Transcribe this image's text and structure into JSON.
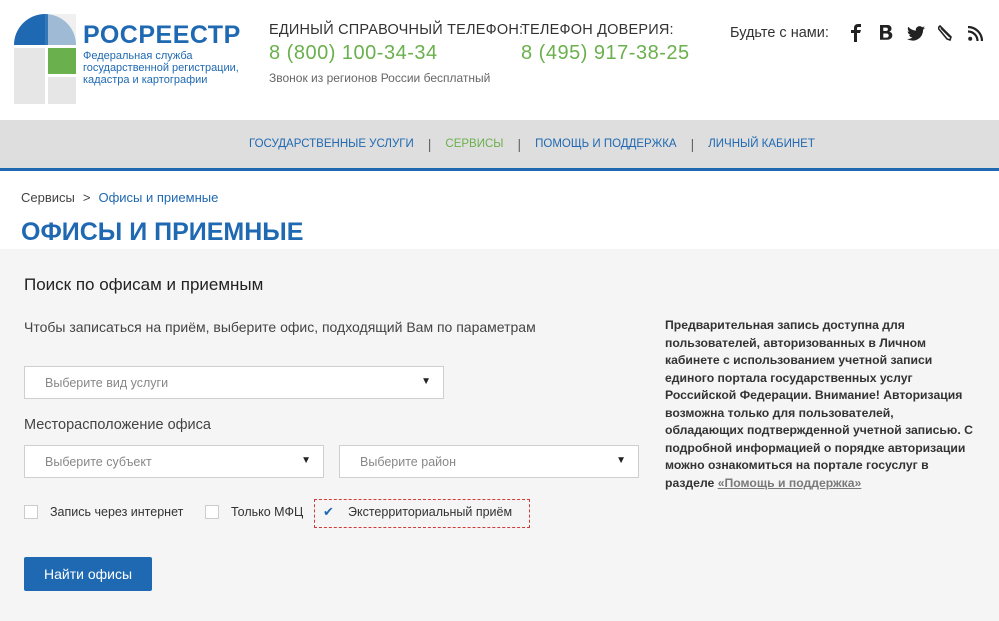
{
  "brand": {
    "name": "РОСРЕЕСТР",
    "subtitle": "Федеральная служба государственной регистрации, кадастра и картографии"
  },
  "phones": [
    {
      "caption": "ЕДИНЫЙ СПРАВОЧНЫЙ ТЕЛЕФОН:",
      "number": "8 (800) 100-34-34",
      "note": "Звонок из регионов России бесплатный"
    },
    {
      "caption": "ТЕЛЕФОН ДОВЕРИЯ:",
      "number": "8 (495) 917-38-25"
    }
  ],
  "social": {
    "label": "Будьте с нами:",
    "icons": [
      "facebook-icon",
      "vkontakte-icon",
      "twitter-icon",
      "livejournal-icon",
      "rss-icon"
    ]
  },
  "nav": {
    "items": [
      {
        "label": "ГОСУДАРСТВЕННЫЕ УСЛУГИ",
        "active": false
      },
      {
        "label": "СЕРВИСЫ",
        "active": true
      },
      {
        "label": "ПОМОЩЬ И ПОДДЕРЖКА",
        "active": false
      },
      {
        "label": "ЛИЧНЫЙ КАБИНЕТ",
        "active": false
      }
    ],
    "separator": "|"
  },
  "breadcrumb": {
    "root": "Сервисы",
    "sep": ">",
    "current": "Офисы и приемные"
  },
  "page_title": "ОФИСЫ И ПРИЕМНЫЕ",
  "search": {
    "title": "Поиск по офисам и приемным",
    "hint": "Чтобы записаться на приём, выберите офис, подходящий Вам по параметрам",
    "service_placeholder": "Выберите вид услуги",
    "location_label": "Месторасположение офиса",
    "subject_placeholder": "Выберите субъект",
    "district_placeholder": "Выберите район",
    "checkboxes": [
      {
        "label": "Запись через интернет",
        "checked": false
      },
      {
        "label": "Только МФЦ",
        "checked": false
      },
      {
        "label": "Экстерриториальный приём",
        "checked": true
      }
    ],
    "submit_label": "Найти офисы"
  },
  "info": {
    "text": "Предварительная запись доступна для пользователей, авторизованных в Личном кабинете с использованием учетной записи единого портала государственных услуг Российской Федерации. Внимание! Авторизация возможна только для пользователей, обладающих подтвержденной учетной записью. С подробной информацией о порядке авторизации можно ознакомиться на портале госуслуг в разделе ",
    "link": "«Помощь и поддержка»"
  },
  "colors": {
    "brand_blue": "#1f69b2",
    "accent_green": "#6ab04c",
    "focus_red": "#d23b3b"
  }
}
